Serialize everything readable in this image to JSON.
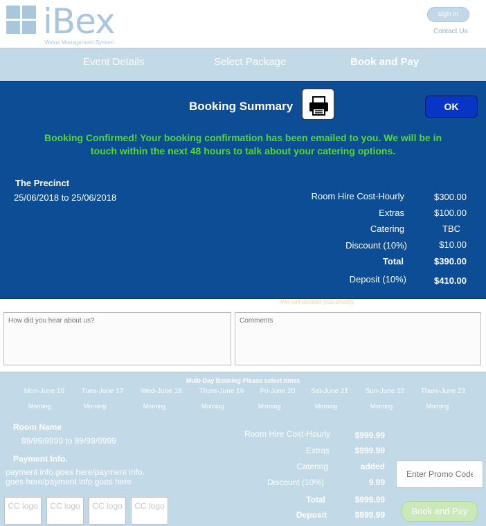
{
  "header": {
    "logo_text": "iBex",
    "logo_subtitle": "Venue Management System",
    "signin_label": "sign in",
    "contact_label": "Contact Us"
  },
  "steps": [
    {
      "label": "Event Details",
      "active": false
    },
    {
      "label": "Select Package",
      "active": false
    },
    {
      "label": "Book and Pay",
      "active": true
    }
  ],
  "modal": {
    "title": "Booking Summary",
    "ok_label": "OK",
    "confirmation": "Booking Confirmed!  Your booking confirmation has been emailed to you. We will be in touch within the next 48 hours to talk about your catering options.",
    "venue": "The Precinct",
    "dates": "25/06/2018 to 25/06/2018",
    "costs": [
      {
        "label": "Room Hire Cost-Hourly",
        "value": "$300.00"
      },
      {
        "label": "Extras",
        "value": "$100.00"
      },
      {
        "label": "Catering",
        "value": "TBC"
      },
      {
        "label": "Discount (10%)",
        "value": "$10.00"
      },
      {
        "label": "Total",
        "value": "$390.00"
      },
      {
        "label": "Deposit (10%)",
        "value": "$410.00"
      }
    ]
  },
  "contact_shortly": "We will contact you shortly.",
  "form": {
    "hear_placeholder": "How did you hear about us?",
    "comments_placeholder": "Comments"
  },
  "multiday": {
    "title": "Multi-Day Booking-Please select times",
    "days": [
      {
        "day": "Mon-June 16",
        "time": "Morning"
      },
      {
        "day": "Tues-June 17",
        "time": "Morning"
      },
      {
        "day": "Wed-June 18",
        "time": "Morning"
      },
      {
        "day": "Thurs-June 19",
        "time": "Morning"
      },
      {
        "day": "Fri-June 20",
        "time": "Morning"
      },
      {
        "day": "Sat-June 21",
        "time": "Morning"
      },
      {
        "day": "Sun-June 22",
        "time": "Morning"
      },
      {
        "day": "Thurs-June 23",
        "time": "Morning"
      }
    ]
  },
  "summary": {
    "room_name_label": "Room Name",
    "room_dates": "99/99/9999 to 99/99/9999",
    "payment_label": "Payment Info.",
    "payment_text": "payment info.goes here/payment info. goes here/payment info.goes here",
    "cc_logo_label": "CC logo",
    "costs": [
      {
        "label": "Room Hire Cost-Hourly",
        "value": "$999.99"
      },
      {
        "label": "Extras",
        "value": "$999.99"
      },
      {
        "label": "Catering",
        "value": "added"
      },
      {
        "label": "Discount (10%)",
        "value": "9.99"
      },
      {
        "label": "Total",
        "value": "$999.99"
      },
      {
        "label": "Deposit",
        "value": "$999.99"
      }
    ],
    "promo_placeholder": "Enter Promo Code",
    "book_pay_label": "Book and Pay"
  }
}
